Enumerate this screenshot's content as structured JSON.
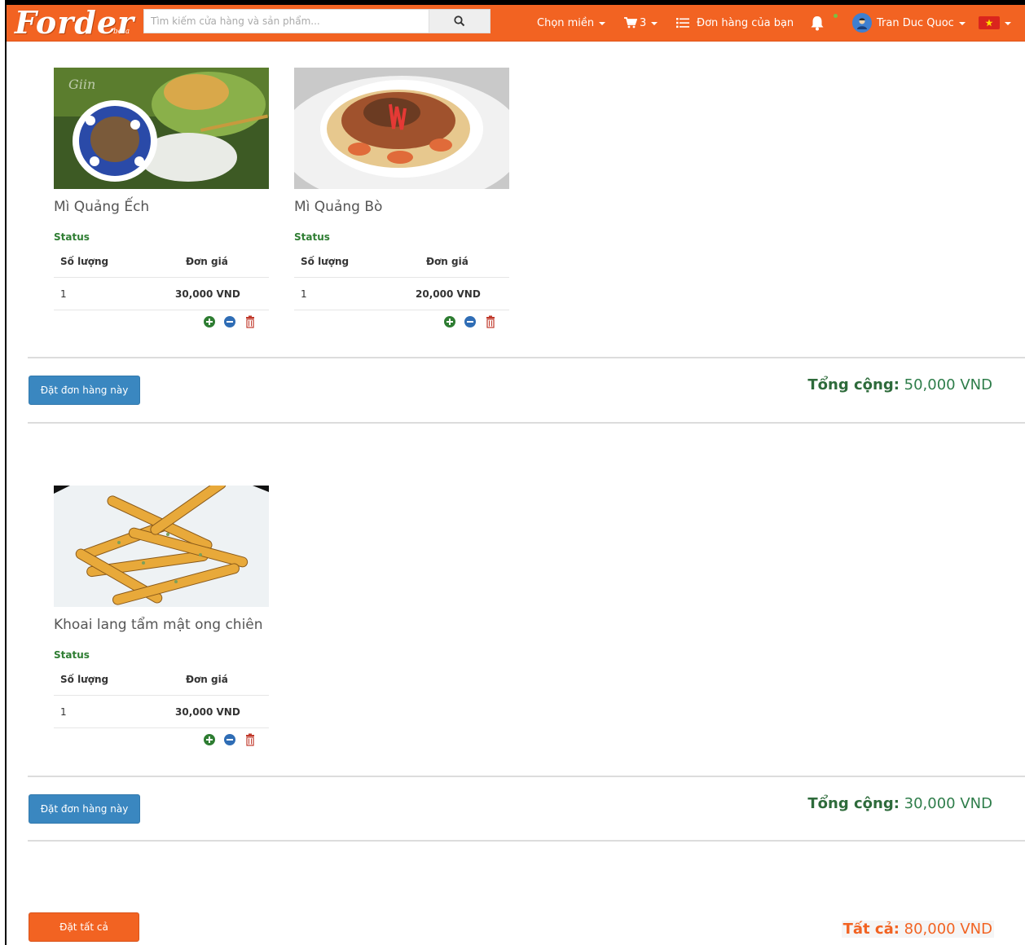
{
  "navbar": {
    "logo": "Forder",
    "logo_sub": "beta",
    "search_placeholder": "Tìm kiếm cửa hàng và sản phẩm...",
    "region_label": "Chọn miền",
    "cart_count": "3",
    "orders_label": "Đơn hàng của bạn",
    "user_name": "Tran Duc Quoc"
  },
  "orders": [
    {
      "items": [
        {
          "name": "Mì Quảng Ếch",
          "status_label": "Status",
          "qty_header": "Số lượng",
          "price_header": "Đơn giá",
          "qty": "1",
          "price": "30,000 VND"
        },
        {
          "name": "Mì Quảng Bò",
          "status_label": "Status",
          "qty_header": "Số lượng",
          "price_header": "Đơn giá",
          "qty": "1",
          "price": "20,000 VND"
        }
      ],
      "order_button": "Đặt đơn hàng này",
      "total_label": "Tổng cộng:",
      "total_value": "50,000 VND"
    },
    {
      "items": [
        {
          "name": "Khoai lang tẩm mật ong chiên",
          "status_label": "Status",
          "qty_header": "Số lượng",
          "price_header": "Đơn giá",
          "qty": "1",
          "price": "30,000 VND"
        }
      ],
      "order_button": "Đặt đơn hàng này",
      "total_label": "Tổng cộng:",
      "total_value": "30,000 VND"
    }
  ],
  "footer": {
    "order_all_button": "Đặt tất cả",
    "grand_label": "Tất cả:",
    "grand_value": "80,000 VND"
  },
  "colors": {
    "brand": "#f26322",
    "primary_button": "#3a87c0",
    "total_green": "#2e7d4a"
  },
  "icons": [
    "search-icon",
    "cart-icon",
    "list-icon",
    "bell-icon",
    "avatar-icon",
    "vietnam-flag-icon",
    "plus-circle-icon",
    "minus-circle-icon",
    "trash-icon"
  ]
}
